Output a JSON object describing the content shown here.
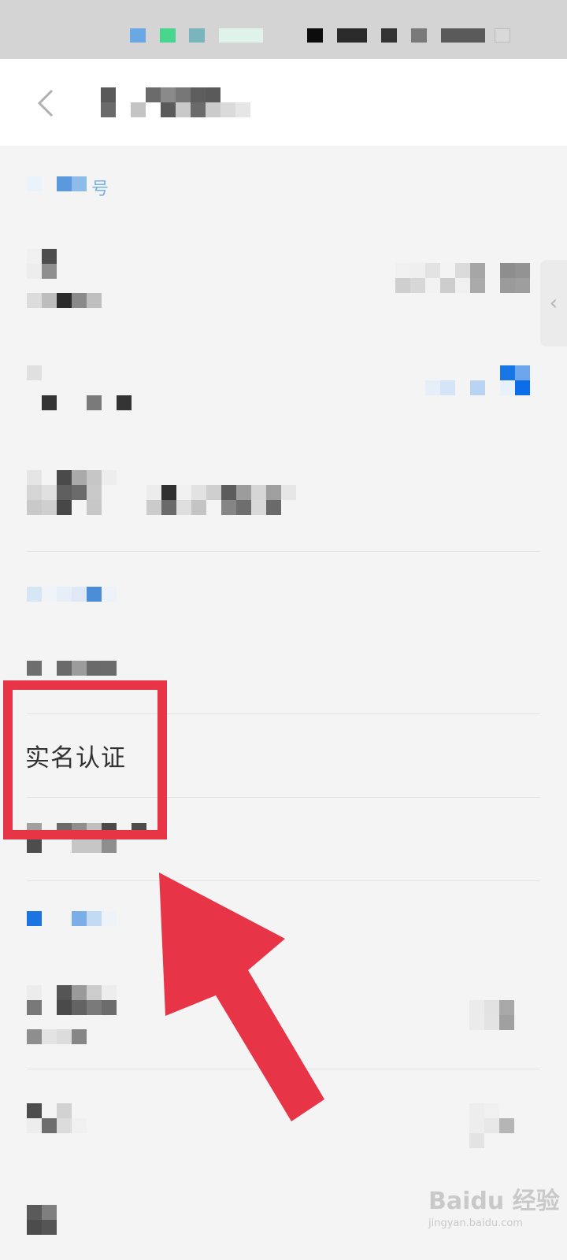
{
  "screen": {
    "real_name_item": "实名认证",
    "section_label_suffix": "号"
  },
  "watermark": {
    "brand": "Baidu 经验",
    "url": "jingyan.baidu.com"
  },
  "colors": {
    "highlight": "#e83447",
    "accent_blue": "#1a73e8",
    "text": "#333333"
  },
  "icons": {
    "back": "chevron-left-icon",
    "side_handle": "chevron-left-icon"
  }
}
